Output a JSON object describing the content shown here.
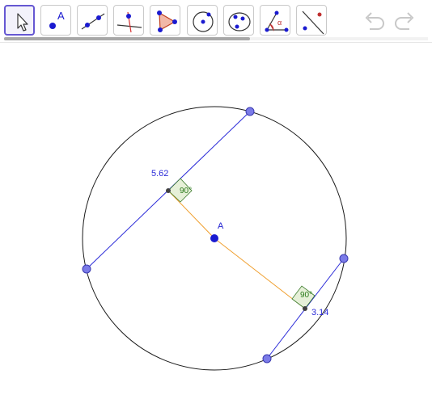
{
  "toolbar": {
    "tools": [
      {
        "name": "move-tool",
        "icon": "cursor-arrow-icon",
        "selected": true
      },
      {
        "name": "point-tool",
        "icon": "point-with-label-icon",
        "label": "A",
        "selected": false
      },
      {
        "name": "line-tool",
        "icon": "line-through-two-points-icon",
        "selected": false
      },
      {
        "name": "perpendicular-line-tool",
        "icon": "perpendicular-line-icon",
        "selected": false
      },
      {
        "name": "polygon-tool",
        "icon": "triangle-polygon-icon",
        "selected": false
      },
      {
        "name": "circle-tool",
        "icon": "circle-center-point-icon",
        "selected": false
      },
      {
        "name": "circle-three-points-tool",
        "icon": "circle-through-points-icon",
        "selected": false
      },
      {
        "name": "angle-tool",
        "icon": "angle-icon",
        "label": "α",
        "selected": false
      },
      {
        "name": "reflect-tool",
        "icon": "reflect-about-line-icon",
        "selected": false
      }
    ],
    "undo_icon": "undo-arrow-icon",
    "redo_icon": "redo-arrow-icon",
    "tool_scroll_fraction": 0.58
  },
  "canvas": {
    "center_label": "A",
    "chord_length_1": "5.62",
    "chord_length_2": "3.14",
    "right_angle_1": "90°",
    "right_angle_2": "90°"
  },
  "colors": {
    "chord": "#2b2bd8",
    "distance_segment": "#f0a030",
    "circle": "#1a1a1a",
    "point_fill": "#7b7be8",
    "point_stroke": "#3a3ab0",
    "center_point": "#1a1ad0",
    "foot_point": "#404040",
    "angle_fill": "#e6f0d8",
    "angle_stroke": "#3a7a2a",
    "angle_text": "#2a7a1a",
    "selection": "#6557d2"
  }
}
